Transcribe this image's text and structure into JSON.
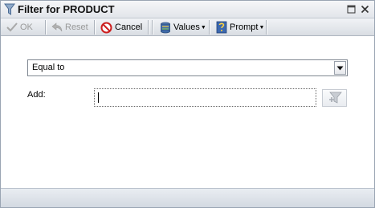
{
  "window": {
    "title": "Filter for PRODUCT"
  },
  "toolbar": {
    "ok_label": "OK",
    "reset_label": "Reset",
    "cancel_label": "Cancel",
    "values_label": "Values",
    "prompt_label": "Prompt"
  },
  "filter": {
    "operator_value": "Equal to",
    "add_label": "Add:",
    "add_value": ""
  },
  "colors": {
    "cancel_icon": "#cc1f1f",
    "disabled_text": "#9a9a9a"
  },
  "icons": [
    "filter-funnel-icon",
    "maximize-icon",
    "close-icon",
    "checkmark-icon",
    "reset-arrow-icon",
    "cancel-icon",
    "values-icon",
    "prompt-icon",
    "dropdown-arrow-icon",
    "add-filter-icon"
  ]
}
